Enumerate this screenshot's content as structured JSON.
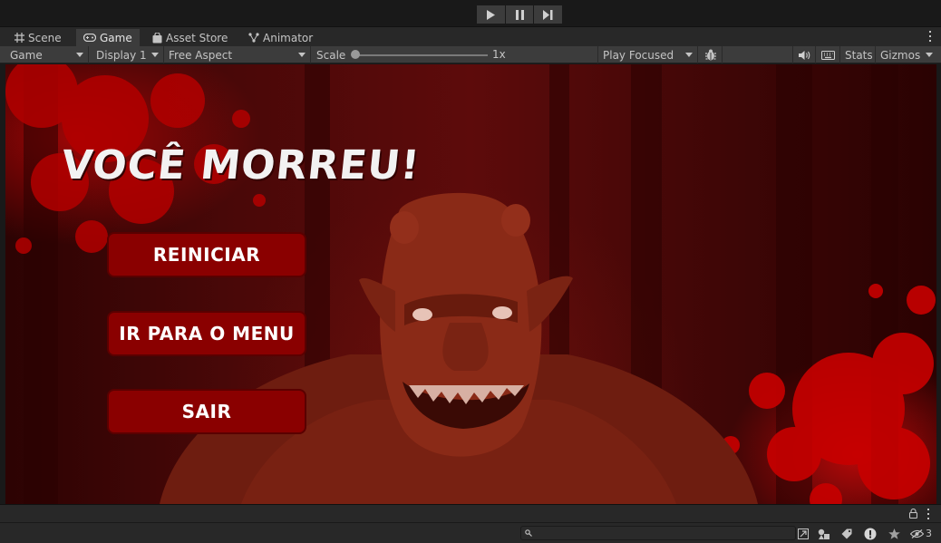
{
  "tabs": [
    {
      "label": "Scene",
      "icon": "grid-icon"
    },
    {
      "label": "Game",
      "icon": "gamepad-icon"
    },
    {
      "label": "Asset Store",
      "icon": "bag-icon"
    },
    {
      "label": "Animator",
      "icon": "animator-icon"
    }
  ],
  "active_tab": "Game",
  "toolbar": {
    "display_type": "Game",
    "display": "Display 1",
    "aspect": "Free Aspect",
    "scale_label": "Scale",
    "scale_value": "1x",
    "scale_slider_level": 0,
    "play_mode": "Play Focused",
    "stats_label": "Stats",
    "gizmos_label": "Gizmos"
  },
  "game": {
    "title": "VOCÊ MORREU!",
    "buttons": [
      "REINICIAR",
      "IR PARA O MENU",
      "SAIR"
    ]
  },
  "status": {
    "search_placeholder": "",
    "hidden_count": "3"
  },
  "colors": {
    "editor_bg": "#282828",
    "toolbar_bg": "#3c3c3c",
    "button_red": "#8a0000",
    "title_white": "#f2f2f2"
  }
}
